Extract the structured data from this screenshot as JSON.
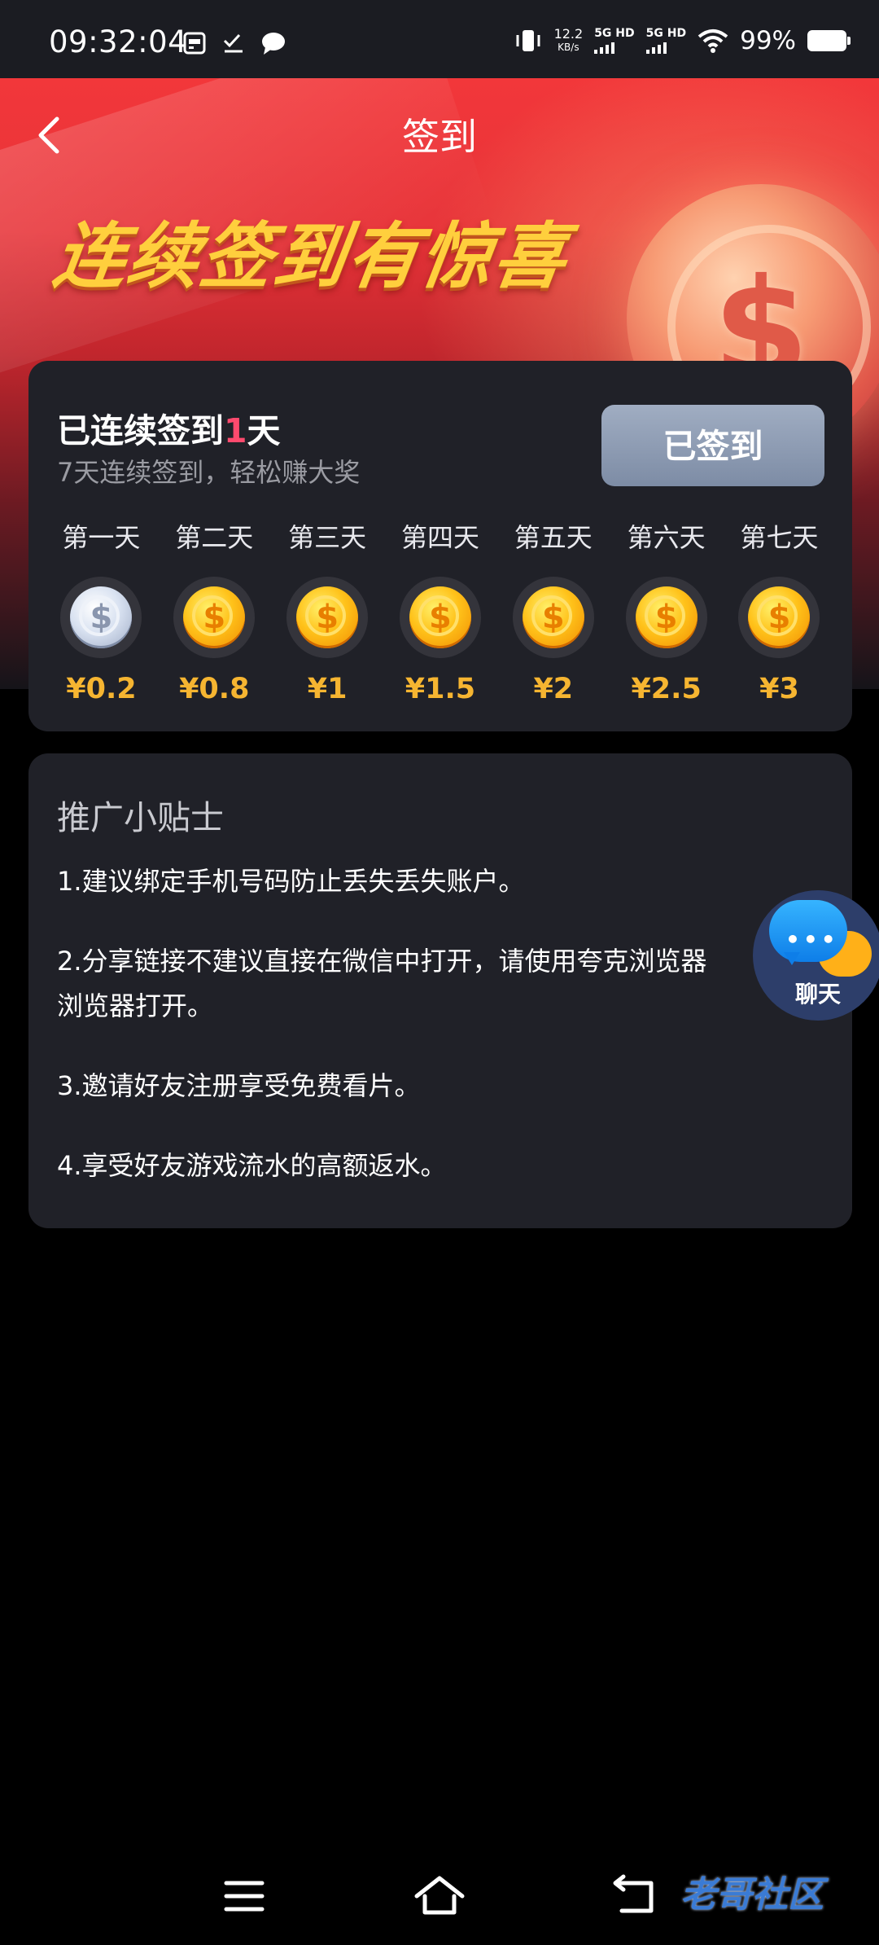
{
  "status_bar": {
    "time": "09:32:04",
    "speed_value": "12.2",
    "speed_unit": "KB/s",
    "net1": "5G HD",
    "net2": "5G HD",
    "battery": "99%"
  },
  "header": {
    "title": "签到",
    "slogan": "连续签到有惊喜"
  },
  "checkin": {
    "title_prefix": "已连续签到",
    "days_count": "1",
    "title_suffix": "天",
    "subtitle": "7天连续签到，轻松赚大奖",
    "button_label": "已签到",
    "days": [
      {
        "label": "第一天",
        "amount": "¥0.2",
        "claimed": true
      },
      {
        "label": "第二天",
        "amount": "¥0.8",
        "claimed": false
      },
      {
        "label": "第三天",
        "amount": "¥1",
        "claimed": false
      },
      {
        "label": "第四天",
        "amount": "¥1.5",
        "claimed": false
      },
      {
        "label": "第五天",
        "amount": "¥2",
        "claimed": false
      },
      {
        "label": "第六天",
        "amount": "¥2.5",
        "claimed": false
      },
      {
        "label": "第七天",
        "amount": "¥3",
        "claimed": false
      }
    ]
  },
  "tips": {
    "title": "推广小贴士",
    "items": [
      "1.建议绑定手机号码防止丢失丢失账户。",
      "2.分享链接不建议直接在微信中打开，请使用夸克浏览器\n浏览器打开。",
      "3.邀请好友注册享受免费看片。",
      "4.享受好友游戏流水的高额返水。"
    ]
  },
  "chat": {
    "label": "聊天"
  },
  "watermark": {
    "text": "老哥社区"
  },
  "colors": {
    "accent_pink": "#ff4a6e",
    "amount_gold": "#f6b531",
    "card_bg": "#202128"
  }
}
